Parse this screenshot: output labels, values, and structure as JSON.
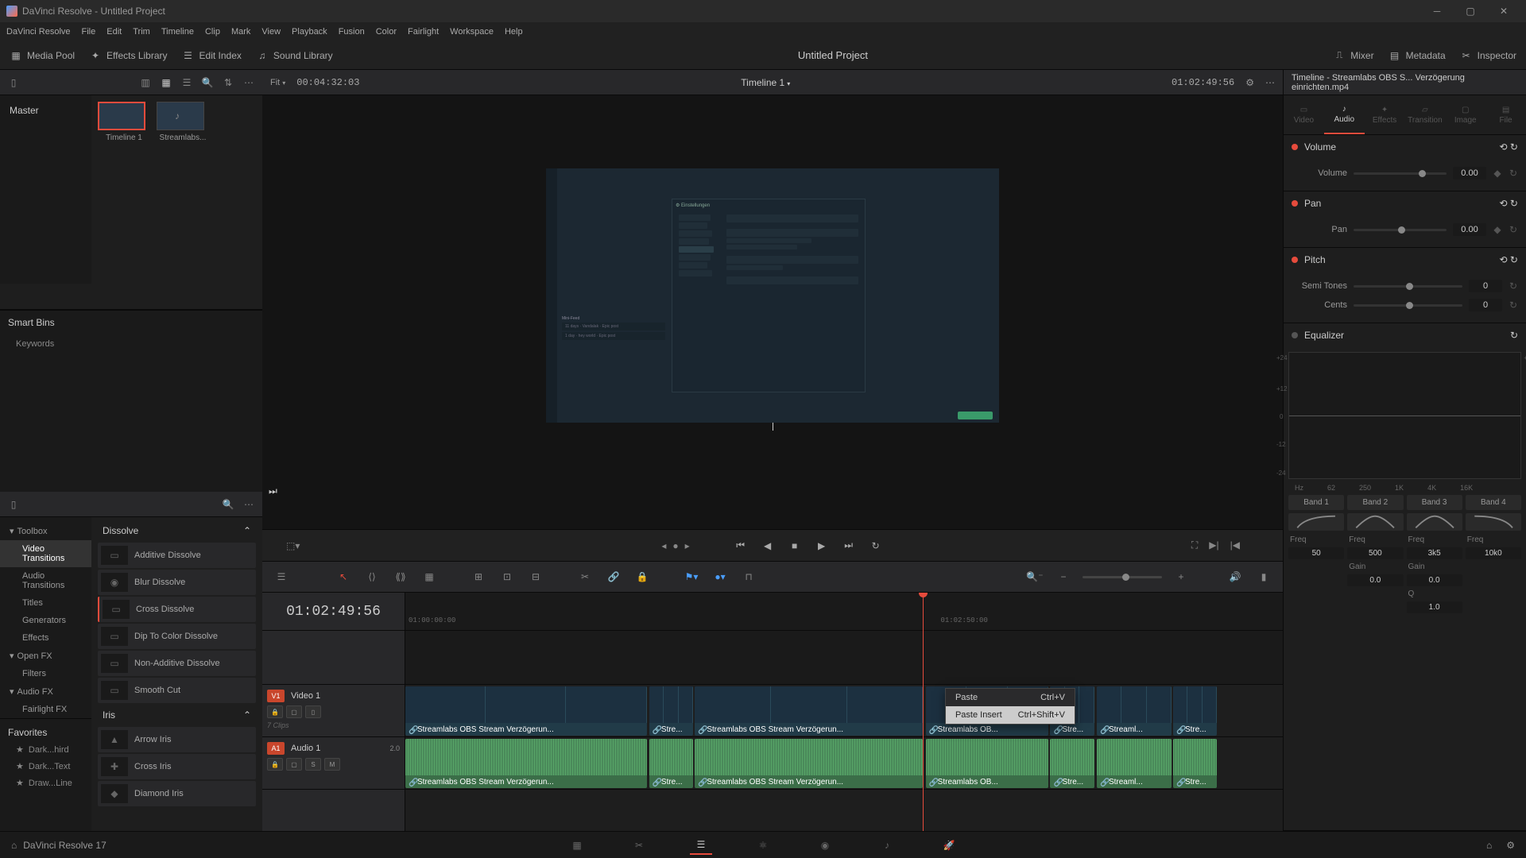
{
  "window": {
    "title": "DaVinci Resolve - Untitled Project"
  },
  "menu": [
    "DaVinci Resolve",
    "File",
    "Edit",
    "Trim",
    "Timeline",
    "Clip",
    "Mark",
    "View",
    "Playback",
    "Fusion",
    "Color",
    "Fairlight",
    "Workspace",
    "Help"
  ],
  "toolbar": {
    "media_pool": "Media Pool",
    "effects_library": "Effects Library",
    "edit_index": "Edit Index",
    "sound_library": "Sound Library",
    "mixer": "Mixer",
    "metadata": "Metadata",
    "inspector": "Inspector",
    "project": "Untitled Project"
  },
  "viewer": {
    "fit": "Fit",
    "in_tc": "00:04:32:03",
    "timeline_name": "Timeline 1",
    "out_tc": "01:02:49:56"
  },
  "media": {
    "master": "Master",
    "clips": [
      {
        "name": "Timeline 1",
        "selected": true
      },
      {
        "name": "Streamlabs...",
        "selected": false
      }
    ],
    "smart_bins": "Smart Bins",
    "keywords": "Keywords"
  },
  "fx": {
    "categories": [
      {
        "label": "Toolbox",
        "expand": true
      },
      {
        "label": "Video Transitions",
        "sub": true,
        "active": true
      },
      {
        "label": "Audio Transitions",
        "sub": true
      },
      {
        "label": "Titles",
        "sub": true
      },
      {
        "label": "Generators",
        "sub": true
      },
      {
        "label": "Effects",
        "sub": true
      },
      {
        "label": "Open FX",
        "expand": true
      },
      {
        "label": "Filters",
        "sub": true
      },
      {
        "label": "Audio FX",
        "expand": true
      },
      {
        "label": "Fairlight FX",
        "sub": true
      }
    ],
    "favorites_label": "Favorites",
    "favorites": [
      "Dark...hird",
      "Dark...Text",
      "Draw...Line"
    ],
    "group1": "Dissolve",
    "dissolve": [
      "Additive Dissolve",
      "Blur Dissolve",
      "Cross Dissolve",
      "Dip To Color Dissolve",
      "Non-Additive Dissolve",
      "Smooth Cut"
    ],
    "group2": "Iris",
    "iris": [
      "Arrow Iris",
      "Cross Iris",
      "Diamond Iris"
    ]
  },
  "timeline": {
    "tc": "01:02:49:56",
    "ruler_ticks": [
      "01:00:00:00",
      "01:02:50:00"
    ],
    "playhead_pct": 59,
    "v1_label": "Video 1",
    "v1_badge": "V1",
    "v1_clips": "7 Clips",
    "a1_label": "Audio 1",
    "a1_badge": "A1",
    "a1_ch": "2.0",
    "clips": [
      {
        "name": "Streamlabs OBS Stream Verzögerun...",
        "start": 0,
        "width": 27.5
      },
      {
        "name": "Stre...",
        "start": 27.8,
        "width": 5
      },
      {
        "name": "Streamlabs OBS Stream Verzögerun...",
        "start": 33,
        "width": 26
      },
      {
        "name": "Streamlabs OB...",
        "start": 59.3,
        "width": 14
      },
      {
        "name": "Stre...",
        "start": 73.5,
        "width": 5
      },
      {
        "name": "Streaml...",
        "start": 78.8,
        "width": 8.5
      },
      {
        "name": "Stre...",
        "start": 87.5,
        "width": 5
      }
    ],
    "context_menu": [
      {
        "label": "Paste",
        "shortcut": "Ctrl+V"
      },
      {
        "label": "Paste Insert",
        "shortcut": "Ctrl+Shift+V",
        "highlight": true
      }
    ]
  },
  "inspector": {
    "title": "Timeline - Streamlabs OBS S... Verzögerung einrichten.mp4",
    "tabs": [
      "Video",
      "Audio",
      "Effects",
      "Transition",
      "Image",
      "File"
    ],
    "active_tab": "Audio",
    "volume": {
      "title": "Volume",
      "label": "Volume",
      "value": "0.00"
    },
    "pan": {
      "title": "Pan",
      "label": "Pan",
      "value": "0.00"
    },
    "pitch": {
      "title": "Pitch",
      "semi_label": "Semi Tones",
      "semi_value": "0",
      "cents_label": "Cents",
      "cents_value": "0"
    },
    "eq": {
      "title": "Equalizer",
      "bands": [
        "Band 1",
        "Band 2",
        "Band 3",
        "Band 4"
      ],
      "freq_label": "Freq",
      "gain_label": "Gain",
      "q_label": "Q",
      "freq": [
        "50",
        "500",
        "3k5",
        "10k0"
      ],
      "gain": [
        "",
        "0.0",
        "0.0",
        ""
      ],
      "q": [
        "",
        "1.0",
        "",
        ""
      ]
    }
  },
  "bottom": {
    "version": "DaVinci Resolve 17"
  }
}
